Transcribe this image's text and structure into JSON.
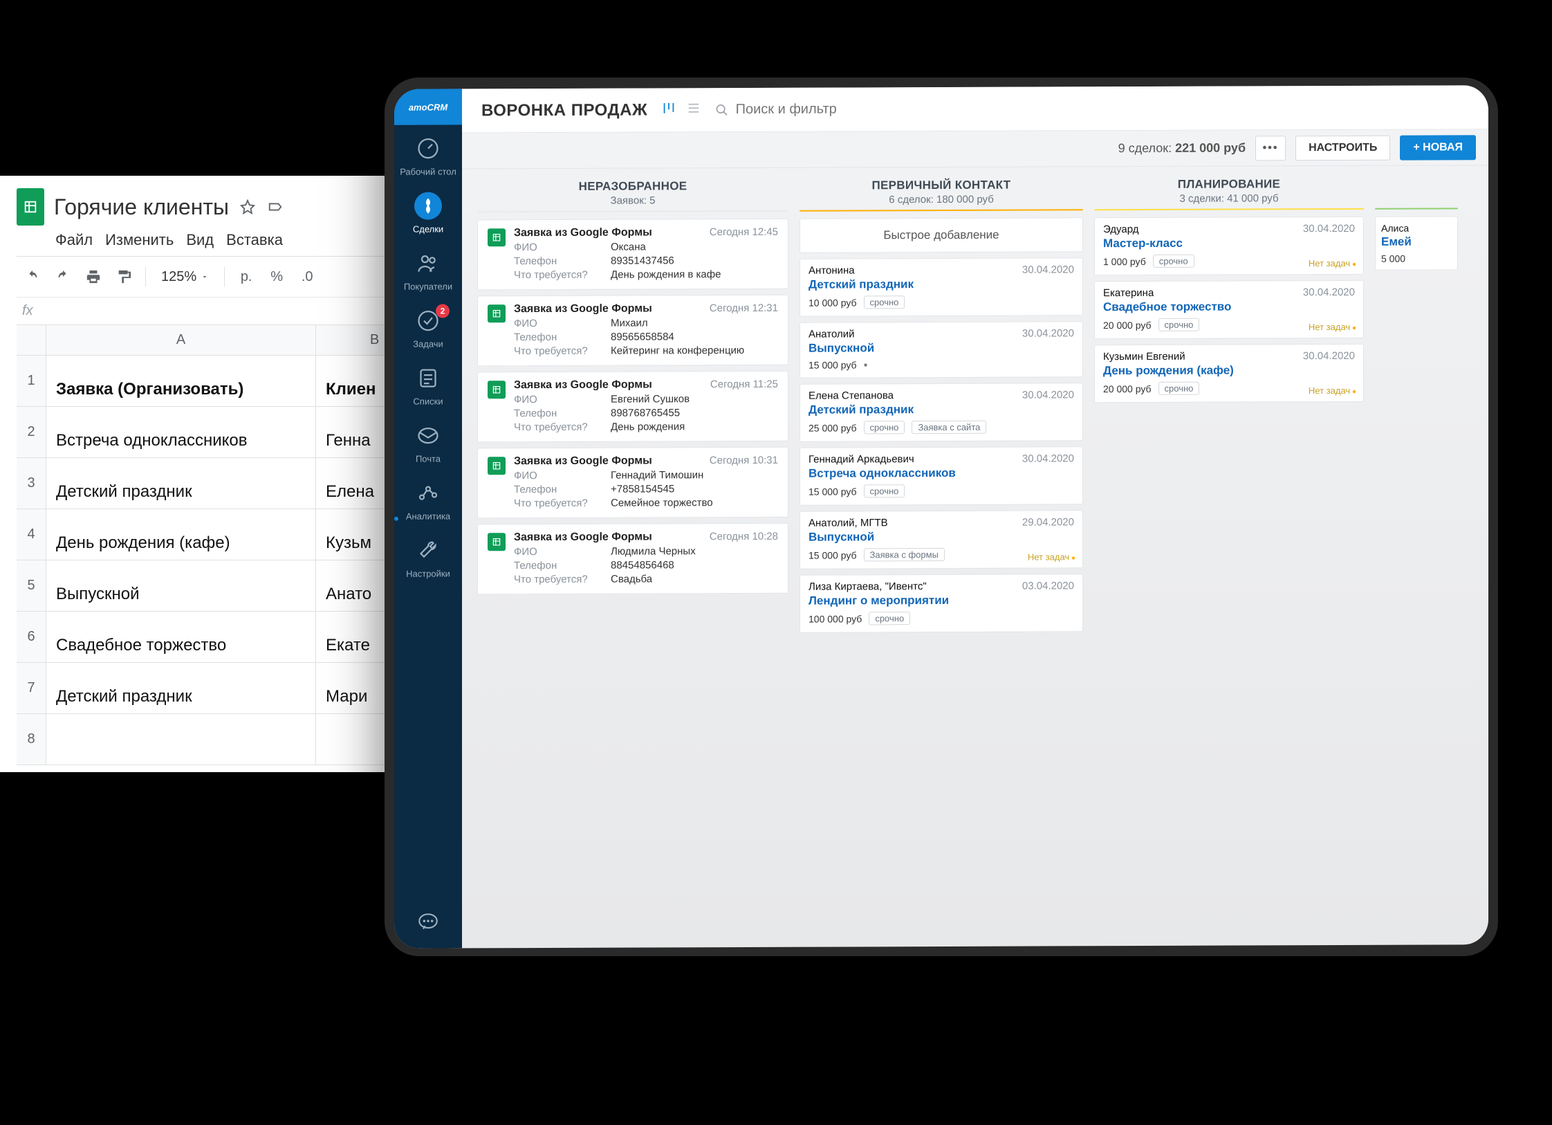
{
  "sheets": {
    "title": "Горячие клиенты",
    "menus": [
      "Файл",
      "Изменить",
      "Вид",
      "Вставка"
    ],
    "zoom": "125%",
    "ruble": "р.",
    "percent": "%",
    "dec0": ".0",
    "col_a_head": "A",
    "col_b_head": "B",
    "header_a": "Заявка (Организовать)",
    "header_b": "Клиен",
    "rows": [
      {
        "a": "Встреча одноклассников",
        "b": "Генна"
      },
      {
        "a": "Детский праздник",
        "b": "Елена"
      },
      {
        "a": "День рождения (кафе)",
        "b": "Кузьм"
      },
      {
        "a": "Выпускной",
        "b": "Анато"
      },
      {
        "a": "Свадебное торжество",
        "b": "Екате"
      },
      {
        "a": "Детский праздник",
        "b": "Мари"
      }
    ]
  },
  "crm": {
    "brand": "amoCRM",
    "nav": {
      "desktop": "Рабочий стол",
      "deals": "Сделки",
      "buyers": "Покупатели",
      "tasks": "Задачи",
      "tasks_badge": "2",
      "lists": "Списки",
      "mail": "Почта",
      "analytics": "Аналитика",
      "settings": "Настройки"
    },
    "header": {
      "title": "ВОРОНКА ПРОДАЖ",
      "search_placeholder": "Поиск и фильтр",
      "deals_count": "9 сделок:",
      "deals_sum": "221 000 руб",
      "configure": "НАСТРОИТЬ",
      "new": "+ НОВАЯ"
    },
    "col1": {
      "title": "НЕРАЗОБРАННОЕ",
      "sub": "Заявок: 5",
      "field_fio": "ФИО",
      "field_phone": "Телефон",
      "field_what": "Что требуется?",
      "items": [
        {
          "title": "Заявка из Google Формы",
          "time": "Сегодня 12:45",
          "fio": "Оксана",
          "phone": "89351437456",
          "what": "День рождения в кафе"
        },
        {
          "title": "Заявка из Google Формы",
          "time": "Сегодня 12:31",
          "fio": "Михаил",
          "phone": "89565658584",
          "what": "Кейтеринг на конференцию"
        },
        {
          "title": "Заявка из Google Формы",
          "time": "Сегодня 11:25",
          "fio": "Евгений Сушков",
          "phone": "898768765455",
          "what": "День рождения"
        },
        {
          "title": "Заявка из Google Формы",
          "time": "Сегодня 10:31",
          "fio": "Геннадий Тимошин",
          "phone": "+7858154545",
          "what": "Семейное торжество"
        },
        {
          "title": "Заявка из Google Формы",
          "time": "Сегодня 10:28",
          "fio": "Людмила Черных",
          "phone": "88454856468",
          "what": "Свадьба"
        }
      ]
    },
    "col2": {
      "title": "ПЕРВИЧНЫЙ КОНТАКТ",
      "sub": "6 сделок: 180 000 руб",
      "quick_add": "Быстрое добавление",
      "items": [
        {
          "contact": "Антонина",
          "date": "30.04.2020",
          "name": "Детский праздник",
          "price": "10 000 руб",
          "tags": [
            "срочно"
          ],
          "notasks": ""
        },
        {
          "contact": "Анатолий",
          "date": "30.04.2020",
          "name": "Выпускной",
          "price": "15 000 руб",
          "tags": [],
          "dot": true,
          "notasks": ""
        },
        {
          "contact": "Елена Степанова",
          "date": "30.04.2020",
          "name": "Детский праздник",
          "price": "25 000 руб",
          "tags": [
            "срочно",
            "Заявка с сайта"
          ],
          "notasks": ""
        },
        {
          "contact": "Геннадий Аркадьевич",
          "date": "30.04.2020",
          "name": "Встреча одноклассников",
          "price": "15 000 руб",
          "tags": [
            "срочно"
          ],
          "notasks": ""
        },
        {
          "contact": "Анатолий, МГТВ",
          "date": "29.04.2020",
          "name": "Выпускной",
          "price": "15 000 руб",
          "tags": [
            "Заявка с формы"
          ],
          "notasks": "Нет задач"
        },
        {
          "contact": "Лиза Киртаева, \"Ивентс\"",
          "date": "03.04.2020",
          "name": "Лендинг о мероприятии",
          "price": "100 000 руб",
          "tags": [
            "срочно"
          ],
          "notasks": ""
        }
      ]
    },
    "col3": {
      "title": "ПЛАНИРОВАНИЕ",
      "sub": "3 сделки: 41 000 руб",
      "items": [
        {
          "contact": "Эдуард",
          "date": "30.04.2020",
          "name": "Мастер-класс",
          "price": "1 000 руб",
          "tags": [
            "срочно"
          ],
          "notasks": "Нет задач"
        },
        {
          "contact": "Екатерина",
          "date": "30.04.2020",
          "name": "Свадебное торжество",
          "price": "20 000 руб",
          "tags": [
            "срочно"
          ],
          "notasks": "Нет задач"
        },
        {
          "contact": "Кузьмин Евгений",
          "date": "30.04.2020",
          "name": "День рождения (кафе)",
          "price": "20 000 руб",
          "tags": [
            "срочно"
          ],
          "notasks": "Нет задач"
        }
      ]
    },
    "col4": {
      "items": [
        {
          "contact": "Алиса",
          "name": "Емей",
          "price": "5 000"
        }
      ]
    }
  }
}
